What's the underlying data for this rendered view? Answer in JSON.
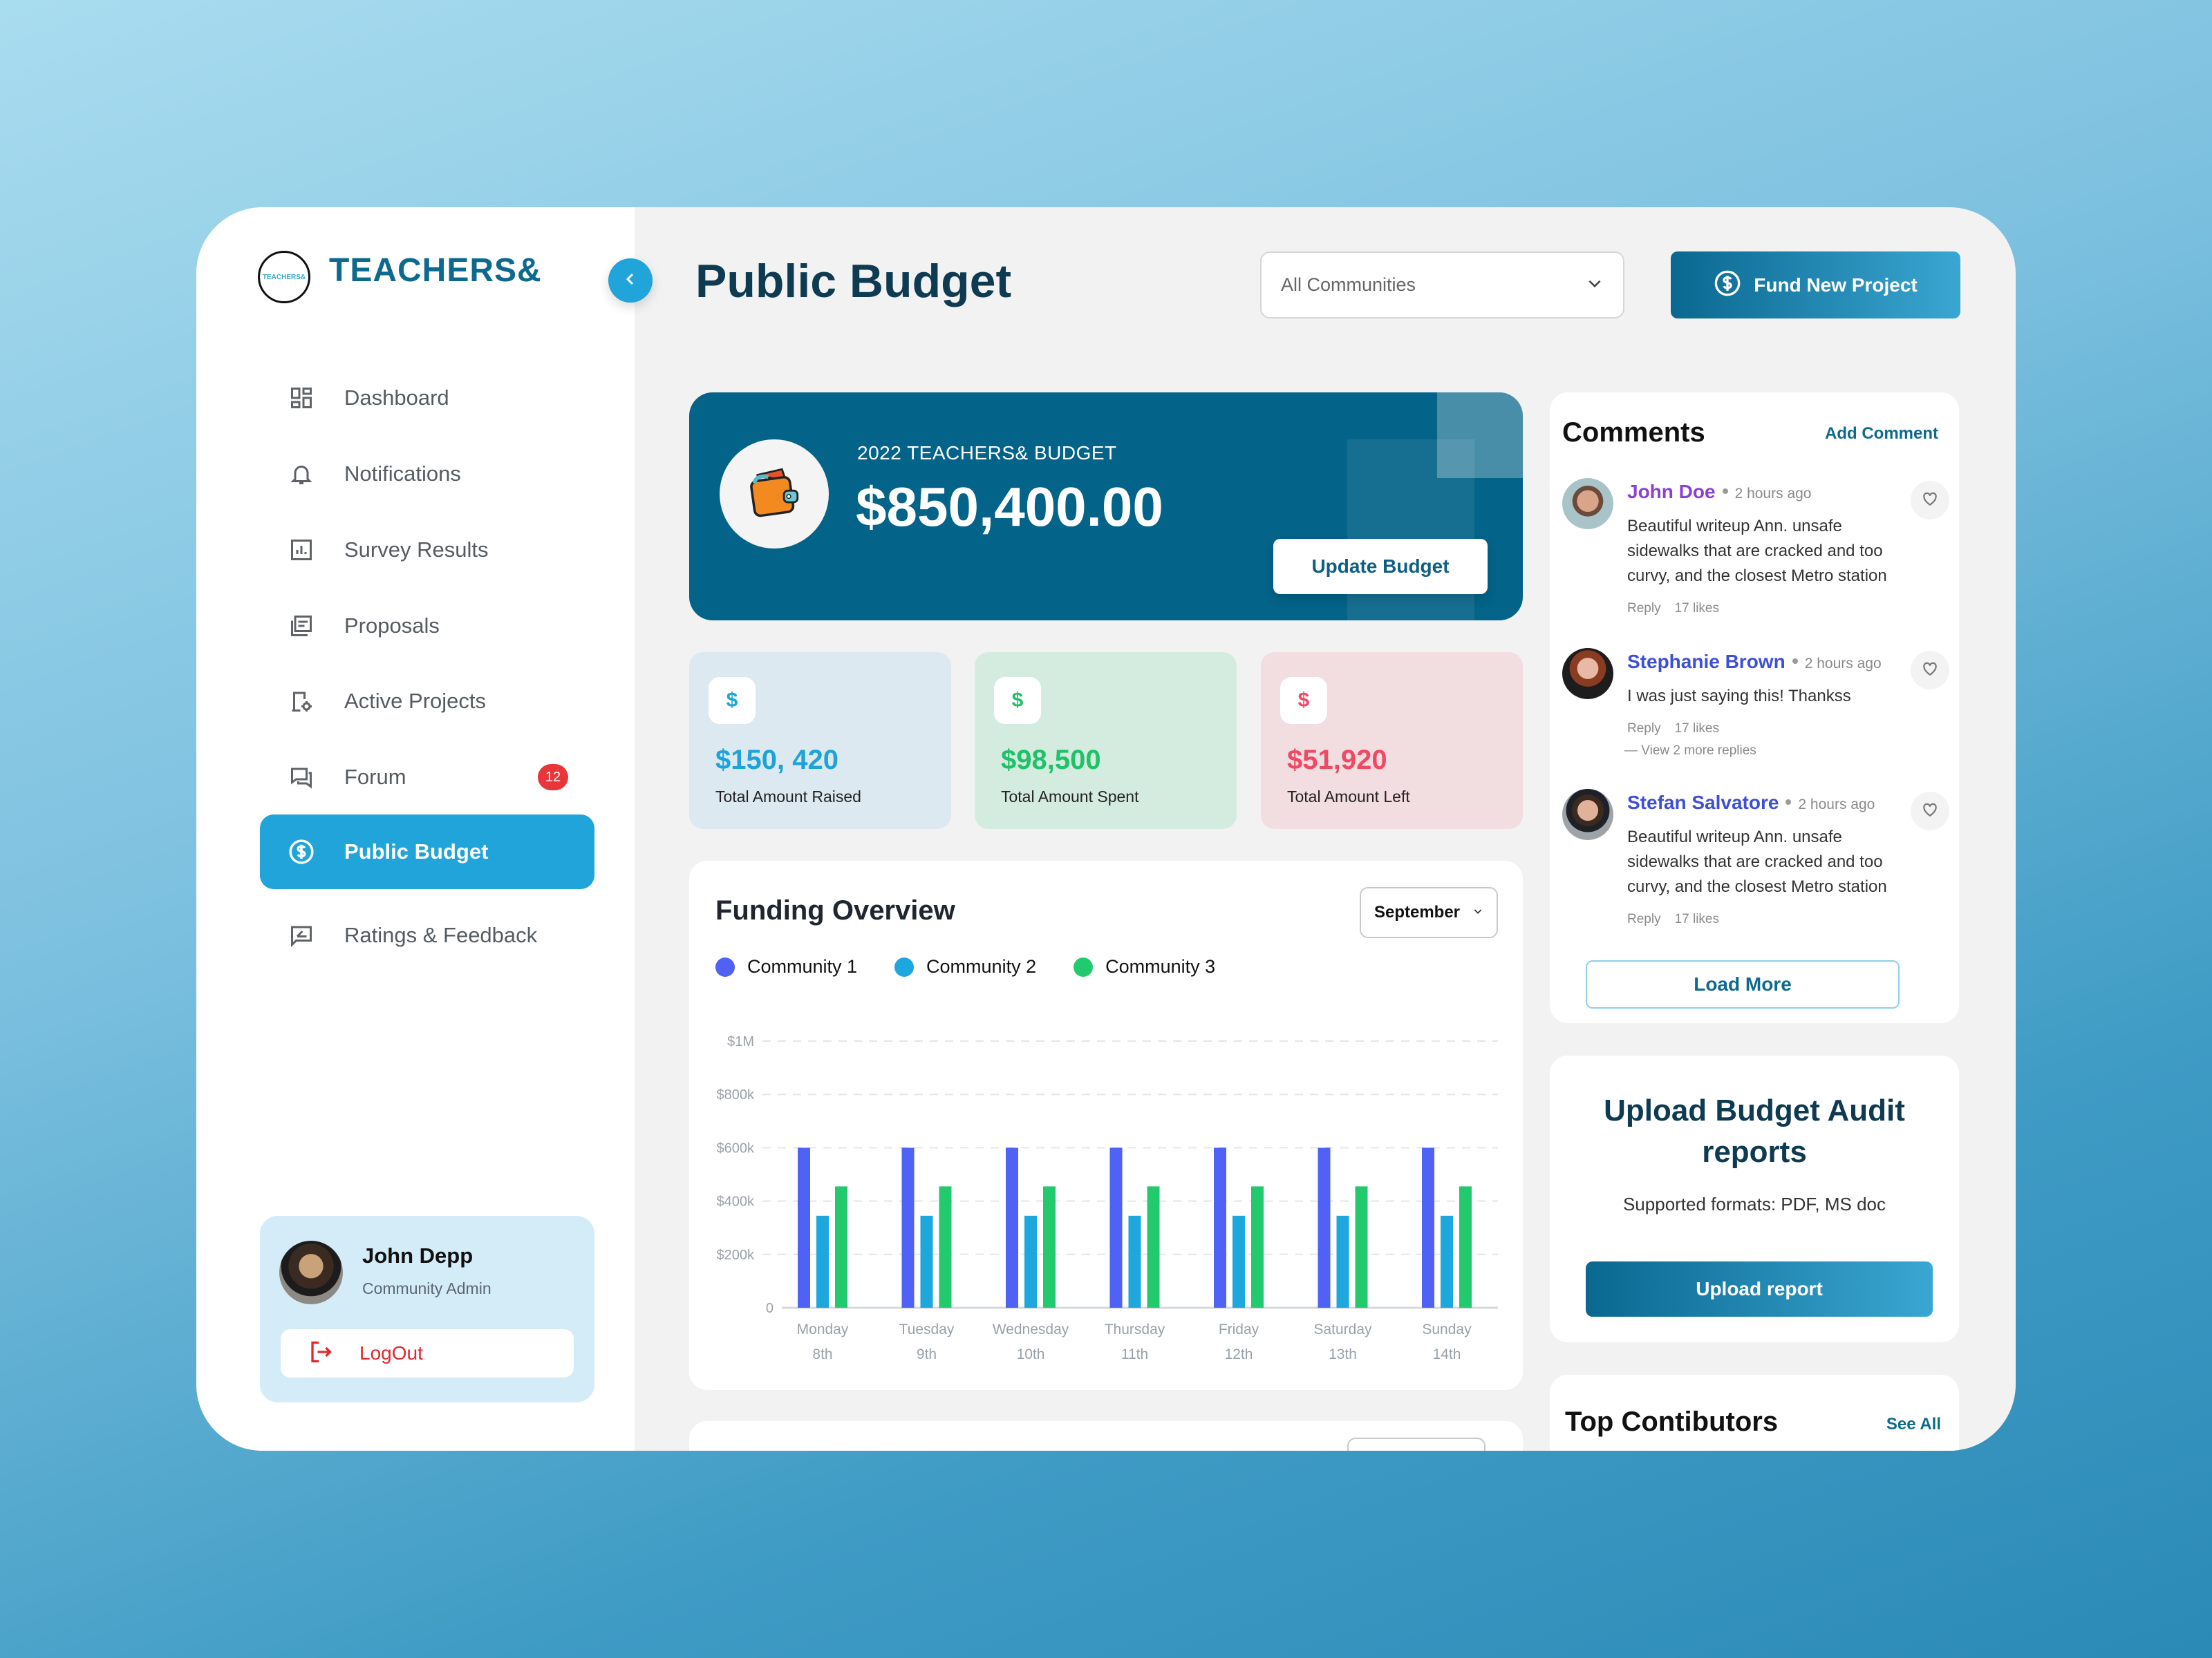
{
  "brand": {
    "name": "TEACHERS&",
    "logo_text": "TEACHERS&"
  },
  "sidebar": {
    "items": [
      {
        "label": "Dashboard",
        "icon": "dashboard-icon",
        "active": false
      },
      {
        "label": "Notifications",
        "icon": "bell-icon",
        "active": false
      },
      {
        "label": "Survey Results",
        "icon": "bar-chart-icon",
        "active": false
      },
      {
        "label": "Proposals",
        "icon": "documents-icon",
        "active": false
      },
      {
        "label": "Active Projects",
        "icon": "project-settings-icon",
        "active": false
      },
      {
        "label": "Forum",
        "icon": "chat-icon",
        "active": false,
        "badge": "12"
      },
      {
        "label": "Public Budget",
        "icon": "dollar-circle-icon",
        "active": true
      },
      {
        "label": "Ratings & Feedback",
        "icon": "feedback-icon",
        "active": false
      }
    ],
    "user": {
      "name": "John Depp",
      "role": "Community Admin",
      "logout_label": "LogOut"
    }
  },
  "header": {
    "title": "Public Budget",
    "community_select": {
      "value": "All Communities"
    },
    "fund_button": "Fund New Project"
  },
  "budget": {
    "caption": "2022 TEACHERS& BUDGET",
    "amount": "$850,400.00",
    "update_button": "Update Budget"
  },
  "stats": [
    {
      "value": "$150, 420",
      "label": "Total Amount Raised",
      "icon": "$",
      "color": "#1ea3d9",
      "bg": "#dde9f0"
    },
    {
      "value": "$98,500",
      "label": "Total Amount Spent",
      "icon": "$",
      "color": "#20c167",
      "bg": "#d4ece0"
    },
    {
      "value": "$51,920",
      "label": "Total Amount Left",
      "icon": "$",
      "color": "#ee4a63",
      "bg": "#f2dde1"
    }
  ],
  "funding": {
    "title": "Funding Overview",
    "month": "September"
  },
  "chart_data": {
    "type": "bar",
    "title": "Funding Overview",
    "categories": [
      "Monday",
      "Tuesday",
      "Wednesday",
      "Thursday",
      "Friday",
      "Saturday",
      "Sunday"
    ],
    "category_sublabels": [
      "8th",
      "9th",
      "10th",
      "11th",
      "12th",
      "13th",
      "14th"
    ],
    "series": [
      {
        "name": "Community 1",
        "color": "#5061f5",
        "values": [
          600000,
          600000,
          600000,
          600000,
          600000,
          600000,
          600000
        ]
      },
      {
        "name": "Community 2",
        "color": "#1ea7dd",
        "values": [
          345000,
          345000,
          345000,
          345000,
          345000,
          345000,
          345000
        ]
      },
      {
        "name": "Community 3",
        "color": "#23ca6d",
        "values": [
          455000,
          455000,
          455000,
          455000,
          455000,
          455000,
          455000
        ]
      }
    ],
    "ylim": [
      0,
      1000000
    ],
    "yticks": [
      0,
      200000,
      400000,
      600000,
      800000,
      1000000
    ],
    "ytick_labels": [
      "0",
      "$200k",
      "$400k",
      "$600k",
      "$800k",
      "$1M"
    ],
    "xlabel": "",
    "ylabel": "",
    "grid": true,
    "legend": "top-left"
  },
  "comments": {
    "title": "Comments",
    "add_label": "Add Comment",
    "items": [
      {
        "name": "John Doe",
        "name_color": "#8a3fd6",
        "time": "2 hours ago",
        "text": "Beautiful writeup Ann.  unsafe sidewalks that are cracked and too curvy, and the closest Metro station",
        "reply": "Reply",
        "likes": "17 likes"
      },
      {
        "name": "Stephanie Brown",
        "name_color": "#3d4fd6",
        "time": "2 hours ago",
        "text": "I was just saying this! Thankss",
        "reply": "Reply",
        "likes": "17 likes",
        "more_replies": "View 2 more replies"
      },
      {
        "name": "Stefan Salvatore",
        "name_color": "#3d4fd6",
        "time": "2 hours ago",
        "text": "Beautiful writeup Ann.  unsafe sidewalks that are cracked and too curvy, and the closest Metro station",
        "reply": "Reply",
        "likes": "17 likes"
      }
    ],
    "load_more": "Load More"
  },
  "upload": {
    "title": "Upload Budget Audit reports",
    "formats": "Supported formats: PDF, MS doc",
    "button": "Upload report"
  },
  "contributors": {
    "title": "Top Contibutors",
    "see_all": "See All"
  }
}
